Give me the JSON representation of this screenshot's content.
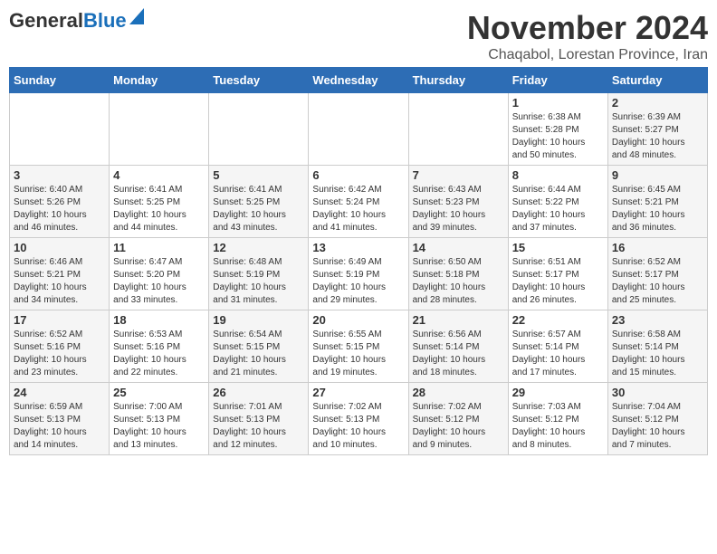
{
  "header": {
    "logo_general": "General",
    "logo_blue": "Blue",
    "month_title": "November 2024",
    "subtitle": "Chaqabol, Lorestan Province, Iran"
  },
  "days_of_week": [
    "Sunday",
    "Monday",
    "Tuesday",
    "Wednesday",
    "Thursday",
    "Friday",
    "Saturday"
  ],
  "weeks": [
    {
      "days": [
        {
          "num": "",
          "info": ""
        },
        {
          "num": "",
          "info": ""
        },
        {
          "num": "",
          "info": ""
        },
        {
          "num": "",
          "info": ""
        },
        {
          "num": "",
          "info": ""
        },
        {
          "num": "1",
          "info": "Sunrise: 6:38 AM\nSunset: 5:28 PM\nDaylight: 10 hours\nand 50 minutes."
        },
        {
          "num": "2",
          "info": "Sunrise: 6:39 AM\nSunset: 5:27 PM\nDaylight: 10 hours\nand 48 minutes."
        }
      ]
    },
    {
      "days": [
        {
          "num": "3",
          "info": "Sunrise: 6:40 AM\nSunset: 5:26 PM\nDaylight: 10 hours\nand 46 minutes."
        },
        {
          "num": "4",
          "info": "Sunrise: 6:41 AM\nSunset: 5:25 PM\nDaylight: 10 hours\nand 44 minutes."
        },
        {
          "num": "5",
          "info": "Sunrise: 6:41 AM\nSunset: 5:25 PM\nDaylight: 10 hours\nand 43 minutes."
        },
        {
          "num": "6",
          "info": "Sunrise: 6:42 AM\nSunset: 5:24 PM\nDaylight: 10 hours\nand 41 minutes."
        },
        {
          "num": "7",
          "info": "Sunrise: 6:43 AM\nSunset: 5:23 PM\nDaylight: 10 hours\nand 39 minutes."
        },
        {
          "num": "8",
          "info": "Sunrise: 6:44 AM\nSunset: 5:22 PM\nDaylight: 10 hours\nand 37 minutes."
        },
        {
          "num": "9",
          "info": "Sunrise: 6:45 AM\nSunset: 5:21 PM\nDaylight: 10 hours\nand 36 minutes."
        }
      ]
    },
    {
      "days": [
        {
          "num": "10",
          "info": "Sunrise: 6:46 AM\nSunset: 5:21 PM\nDaylight: 10 hours\nand 34 minutes."
        },
        {
          "num": "11",
          "info": "Sunrise: 6:47 AM\nSunset: 5:20 PM\nDaylight: 10 hours\nand 33 minutes."
        },
        {
          "num": "12",
          "info": "Sunrise: 6:48 AM\nSunset: 5:19 PM\nDaylight: 10 hours\nand 31 minutes."
        },
        {
          "num": "13",
          "info": "Sunrise: 6:49 AM\nSunset: 5:19 PM\nDaylight: 10 hours\nand 29 minutes."
        },
        {
          "num": "14",
          "info": "Sunrise: 6:50 AM\nSunset: 5:18 PM\nDaylight: 10 hours\nand 28 minutes."
        },
        {
          "num": "15",
          "info": "Sunrise: 6:51 AM\nSunset: 5:17 PM\nDaylight: 10 hours\nand 26 minutes."
        },
        {
          "num": "16",
          "info": "Sunrise: 6:52 AM\nSunset: 5:17 PM\nDaylight: 10 hours\nand 25 minutes."
        }
      ]
    },
    {
      "days": [
        {
          "num": "17",
          "info": "Sunrise: 6:52 AM\nSunset: 5:16 PM\nDaylight: 10 hours\nand 23 minutes."
        },
        {
          "num": "18",
          "info": "Sunrise: 6:53 AM\nSunset: 5:16 PM\nDaylight: 10 hours\nand 22 minutes."
        },
        {
          "num": "19",
          "info": "Sunrise: 6:54 AM\nSunset: 5:15 PM\nDaylight: 10 hours\nand 21 minutes."
        },
        {
          "num": "20",
          "info": "Sunrise: 6:55 AM\nSunset: 5:15 PM\nDaylight: 10 hours\nand 19 minutes."
        },
        {
          "num": "21",
          "info": "Sunrise: 6:56 AM\nSunset: 5:14 PM\nDaylight: 10 hours\nand 18 minutes."
        },
        {
          "num": "22",
          "info": "Sunrise: 6:57 AM\nSunset: 5:14 PM\nDaylight: 10 hours\nand 17 minutes."
        },
        {
          "num": "23",
          "info": "Sunrise: 6:58 AM\nSunset: 5:14 PM\nDaylight: 10 hours\nand 15 minutes."
        }
      ]
    },
    {
      "days": [
        {
          "num": "24",
          "info": "Sunrise: 6:59 AM\nSunset: 5:13 PM\nDaylight: 10 hours\nand 14 minutes."
        },
        {
          "num": "25",
          "info": "Sunrise: 7:00 AM\nSunset: 5:13 PM\nDaylight: 10 hours\nand 13 minutes."
        },
        {
          "num": "26",
          "info": "Sunrise: 7:01 AM\nSunset: 5:13 PM\nDaylight: 10 hours\nand 12 minutes."
        },
        {
          "num": "27",
          "info": "Sunrise: 7:02 AM\nSunset: 5:13 PM\nDaylight: 10 hours\nand 10 minutes."
        },
        {
          "num": "28",
          "info": "Sunrise: 7:02 AM\nSunset: 5:12 PM\nDaylight: 10 hours\nand 9 minutes."
        },
        {
          "num": "29",
          "info": "Sunrise: 7:03 AM\nSunset: 5:12 PM\nDaylight: 10 hours\nand 8 minutes."
        },
        {
          "num": "30",
          "info": "Sunrise: 7:04 AM\nSunset: 5:12 PM\nDaylight: 10 hours\nand 7 minutes."
        }
      ]
    }
  ]
}
